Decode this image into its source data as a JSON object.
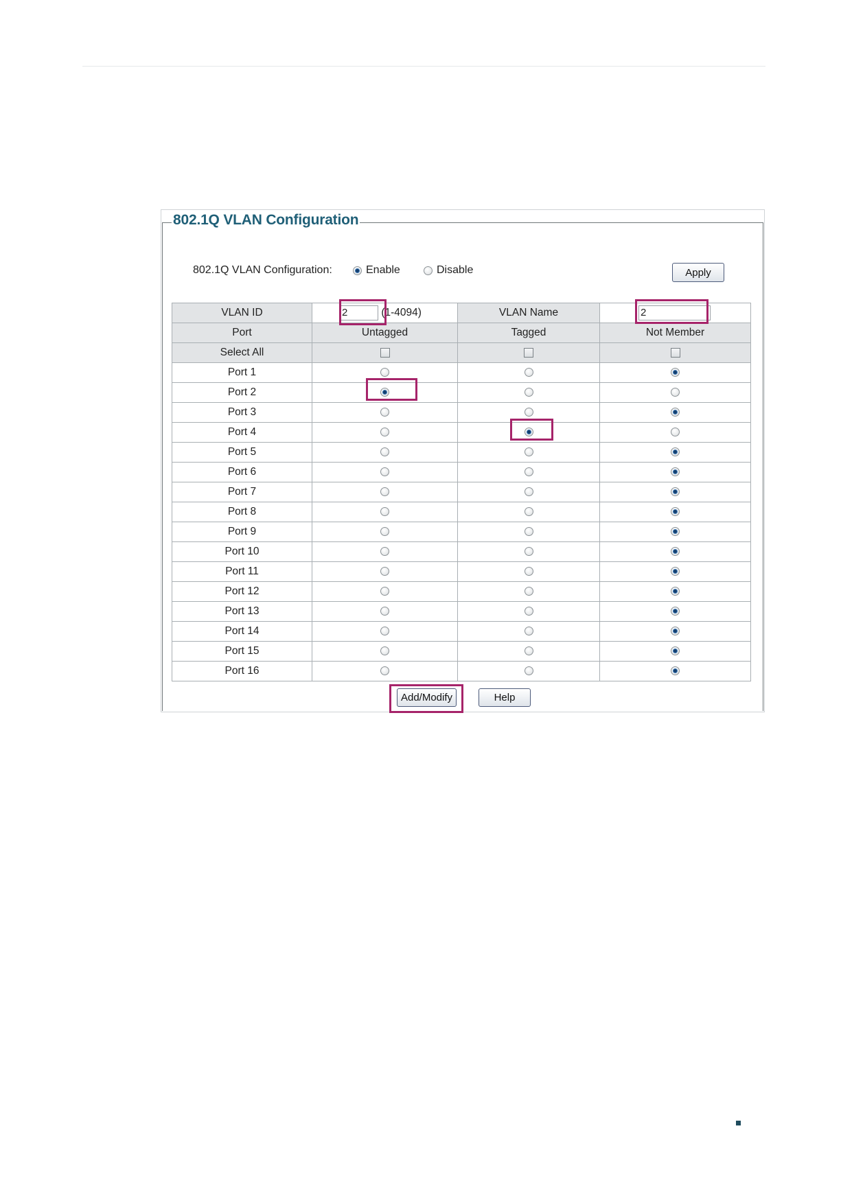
{
  "panel": {
    "title": "802.1Q VLAN Configuration",
    "config_label": "802.1Q VLAN Configuration:",
    "enable_label": "Enable",
    "disable_label": "Disable",
    "apply_label": "Apply",
    "selected_mode": "Enable"
  },
  "table": {
    "vlan_id_label": "VLAN ID",
    "vlan_id_value": "2",
    "vlan_id_range": "(1-4094)",
    "vlan_name_label": "VLAN Name",
    "vlan_name_value": "2",
    "columns": [
      "Port",
      "Untagged",
      "Tagged",
      "Not Member"
    ],
    "select_all_label": "Select All",
    "rows": [
      {
        "port": "Port 1",
        "membership": "Not Member"
      },
      {
        "port": "Port 2",
        "membership": "Untagged"
      },
      {
        "port": "Port 3",
        "membership": "Not Member"
      },
      {
        "port": "Port 4",
        "membership": "Tagged"
      },
      {
        "port": "Port 5",
        "membership": "Not Member"
      },
      {
        "port": "Port 6",
        "membership": "Not Member"
      },
      {
        "port": "Port 7",
        "membership": "Not Member"
      },
      {
        "port": "Port 8",
        "membership": "Not Member"
      },
      {
        "port": "Port 9",
        "membership": "Not Member"
      },
      {
        "port": "Port 10",
        "membership": "Not Member"
      },
      {
        "port": "Port 11",
        "membership": "Not Member"
      },
      {
        "port": "Port 12",
        "membership": "Not Member"
      },
      {
        "port": "Port 13",
        "membership": "Not Member"
      },
      {
        "port": "Port 14",
        "membership": "Not Member"
      },
      {
        "port": "Port 15",
        "membership": "Not Member"
      },
      {
        "port": "Port 16",
        "membership": "Not Member"
      }
    ]
  },
  "buttons": {
    "add_modify_label": "Add/Modify",
    "help_label": "Help"
  },
  "colors": {
    "title": "#1f5f77",
    "highlight": "#a6246a",
    "radio_selected": "#143f6e",
    "header_row": "#e2e4e6"
  }
}
